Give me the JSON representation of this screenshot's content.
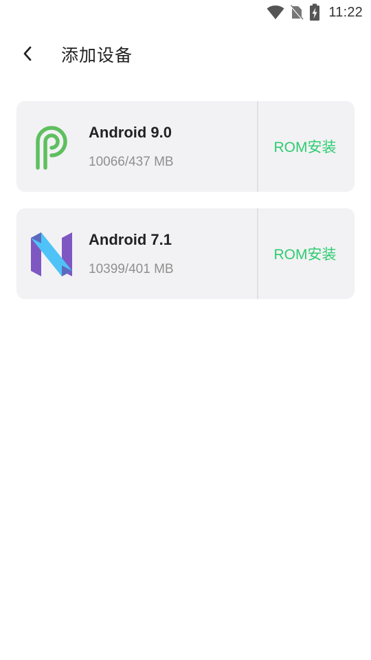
{
  "status_bar": {
    "time": "11:22",
    "icons": [
      "wifi-icon",
      "no-sim-icon",
      "battery-charging-icon"
    ]
  },
  "header": {
    "back_icon": "chevron-left-icon",
    "title": "添加设备"
  },
  "devices": [
    {
      "logo": "android-pie-logo",
      "name": "Android 9.0",
      "size": "10066/437 MB",
      "action": "ROM安装",
      "logo_color": "#5fbf5f"
    },
    {
      "logo": "android-nougat-logo",
      "name": "Android 7.1",
      "size": "10399/401 MB",
      "action": "ROM安装",
      "logo_colors": [
        "#7e57c2",
        "#4fc3f7"
      ]
    }
  ],
  "colors": {
    "accent": "#2ecc71",
    "card_bg": "#f2f2f4"
  }
}
